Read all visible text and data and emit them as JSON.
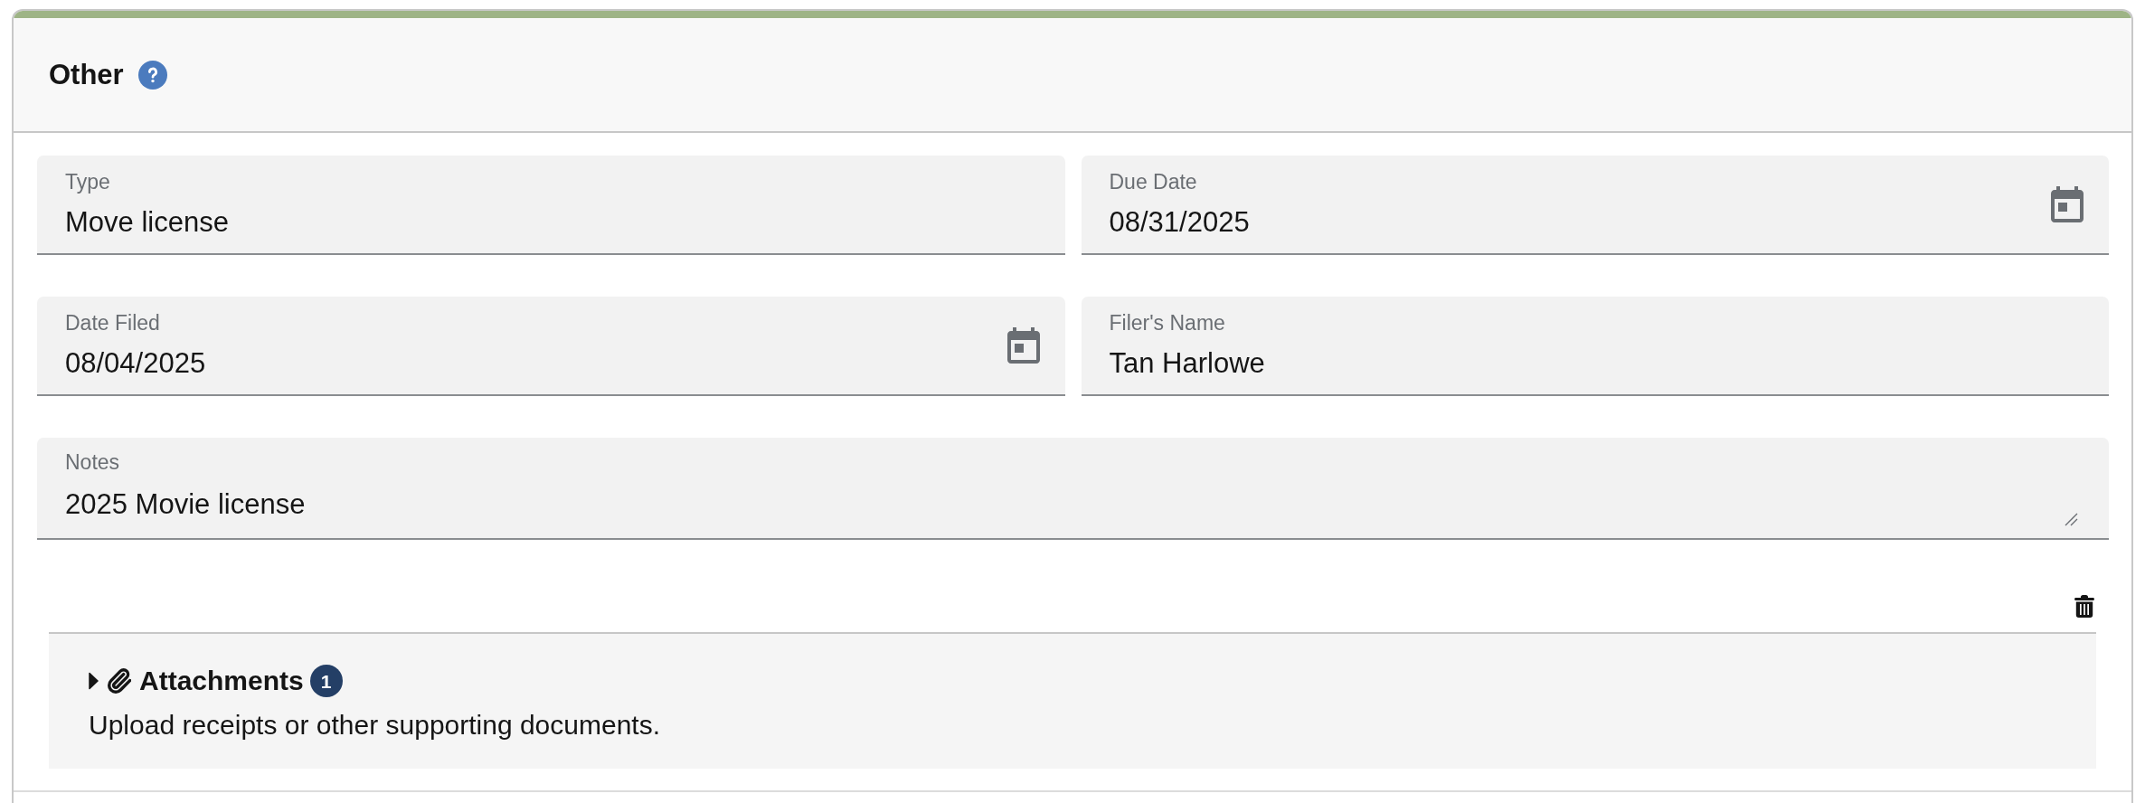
{
  "header": {
    "title": "Other"
  },
  "fields": [
    {
      "kind": "text",
      "label": "Type",
      "value": "Move license"
    },
    {
      "kind": "date",
      "label": "Due Date",
      "value": "08/31/2025"
    },
    {
      "kind": "date",
      "label": "Date Filed",
      "value": "08/04/2025"
    },
    {
      "kind": "text",
      "label": "Filer's Name",
      "value": "Tan Harlowe"
    },
    {
      "kind": "textarea",
      "label": "Notes",
      "value": "2025 Movie license"
    }
  ],
  "attachments": {
    "title": "Attachments",
    "count": "1",
    "expanded": false,
    "description": "Upload receipts or other supporting documents."
  }
}
